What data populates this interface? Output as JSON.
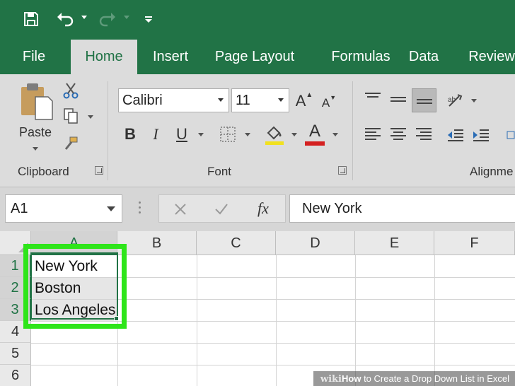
{
  "quick_access": {
    "icons": [
      "save-icon",
      "undo-icon",
      "redo-icon",
      "customize-quick-access-icon"
    ]
  },
  "tabs": [
    {
      "label": "File",
      "active": false
    },
    {
      "label": "Home",
      "active": true
    },
    {
      "label": "Insert",
      "active": false
    },
    {
      "label": "Page Layout",
      "active": false
    },
    {
      "label": "Formulas",
      "active": false
    },
    {
      "label": "Data",
      "active": false
    },
    {
      "label": "Review",
      "active": false
    }
  ],
  "ribbon": {
    "clipboard": {
      "paste_label": "Paste",
      "group_label": "Clipboard"
    },
    "font": {
      "font_name": "Calibri",
      "font_size": "11",
      "group_label": "Font",
      "bold": "B",
      "italic": "I",
      "underline": "U",
      "grow": "A",
      "shrink": "A",
      "font_color_glyph": "A"
    },
    "alignment": {
      "group_label": "Alignme"
    }
  },
  "formula_bar": {
    "name_box": "A1",
    "fx": "fx",
    "value": "New York"
  },
  "grid": {
    "columns": [
      "A",
      "B",
      "C",
      "D",
      "E",
      "F"
    ],
    "rows": [
      "1",
      "2",
      "3",
      "4",
      "5",
      "6"
    ],
    "cells": {
      "A1": "New York",
      "A2": "Boston",
      "A3": "Los Angeles"
    }
  },
  "watermark": {
    "wiki": "wiki",
    "how": "How",
    "rest": " to Create a Drop Down List in Excel"
  },
  "colors": {
    "excel_green": "#217346",
    "highlight": "#2ee51a",
    "fill_yellow": "#f1e11f",
    "font_red": "#d42020"
  }
}
